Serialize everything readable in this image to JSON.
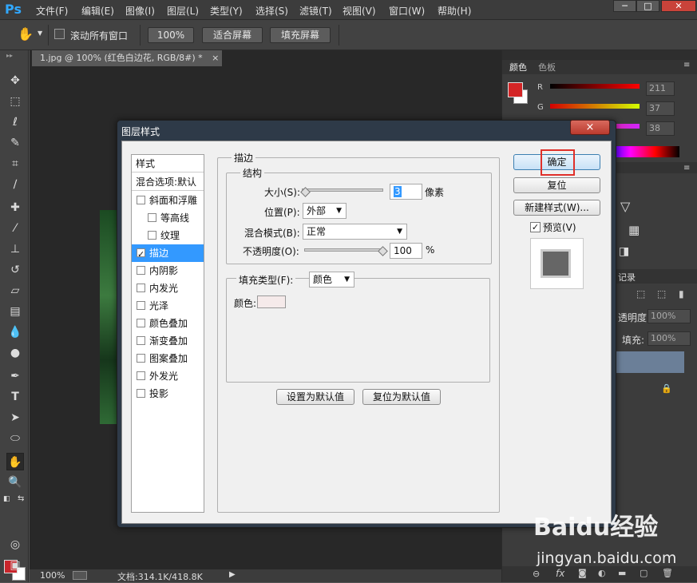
{
  "app": {
    "logo": "Ps"
  },
  "menu": [
    "文件(F)",
    "编辑(E)",
    "图像(I)",
    "图层(L)",
    "类型(Y)",
    "选择(S)",
    "滤镜(T)",
    "视图(V)",
    "窗口(W)",
    "帮助(H)"
  ],
  "options": {
    "scroll_all_label": "滚动所有窗口",
    "zoom_100": "100%",
    "fit_screen": "适合屏幕",
    "fill_screen": "填充屏幕"
  },
  "document": {
    "tab_title": "1.jpg @ 100% (红色白边花, RGB/8#) *",
    "close": "×"
  },
  "status": {
    "zoom": "100%",
    "doc_size": "文档:314.1K/418.8K"
  },
  "right_panel": {
    "tab_color": "颜色",
    "tab_swatches": "色板",
    "r_label": "R",
    "g_label": "G",
    "r_value": "211",
    "g_value": "37",
    "b_value": "38",
    "history_label": "记录",
    "opacity_label": "透明度:",
    "opacity_value": "100%",
    "fill_label": "填充:",
    "fill_value": "100%"
  },
  "dialog": {
    "title": "图层样式",
    "close": "×",
    "styles_header": "样式",
    "blend_options": "混合选项:默认",
    "style_items": [
      {
        "label": "斜面和浮雕",
        "checked": false,
        "indent": false
      },
      {
        "label": "等高线",
        "checked": false,
        "indent": true
      },
      {
        "label": "纹理",
        "checked": false,
        "indent": true
      },
      {
        "label": "描边",
        "checked": true,
        "indent": false,
        "selected": true
      },
      {
        "label": "内阴影",
        "checked": false,
        "indent": false
      },
      {
        "label": "内发光",
        "checked": false,
        "indent": false
      },
      {
        "label": "光泽",
        "checked": false,
        "indent": false
      },
      {
        "label": "颜色叠加",
        "checked": false,
        "indent": false
      },
      {
        "label": "渐变叠加",
        "checked": false,
        "indent": false
      },
      {
        "label": "图案叠加",
        "checked": false,
        "indent": false
      },
      {
        "label": "外发光",
        "checked": false,
        "indent": false
      },
      {
        "label": "投影",
        "checked": false,
        "indent": false
      }
    ],
    "stroke_group": "描边",
    "structure_group": "结构",
    "size_label": "大小(S):",
    "size_value": "3",
    "size_unit": "像素",
    "position_label": "位置(P):",
    "position_value": "外部",
    "blend_label": "混合模式(B):",
    "blend_value": "正常",
    "opacity_label": "不透明度(O):",
    "opacity_value": "100",
    "opacity_unit": "%",
    "fill_type_label": "填充类型(F):",
    "fill_type_value": "颜色",
    "color_label": "颜色:",
    "stroke_color": "#f5eaea",
    "set_default": "设置为默认值",
    "reset_default": "复位为默认值",
    "ok": "确定",
    "reset": "复位",
    "new_style": "新建样式(W)...",
    "preview_label": "预览(V)",
    "preview_checked": true
  },
  "watermark": {
    "brand": "Baidu经验",
    "url": "jingyan.baidu.com"
  },
  "colors": {
    "highlight_box": "#e0302a",
    "foreground": "#d32526",
    "selection": "#3399ff"
  }
}
